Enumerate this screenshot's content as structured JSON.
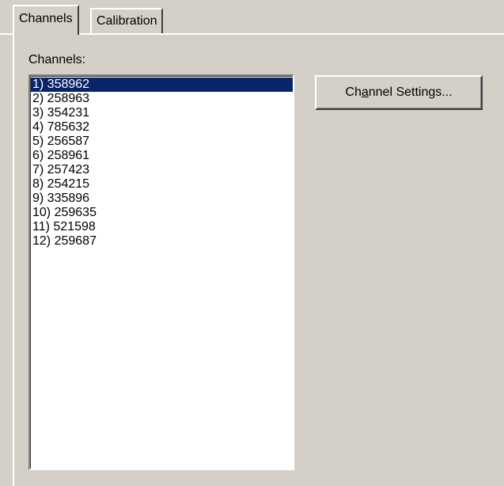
{
  "tabs": [
    {
      "label": "Channels",
      "active": true
    },
    {
      "label": "Calibration",
      "active": false
    }
  ],
  "channels_label": "Channels:",
  "channels": [
    "1) 358962",
    "2) 258963",
    "3) 354231",
    "4) 785632",
    "5) 256587",
    "6) 258961",
    "7) 257423",
    "8) 254215",
    "9) 335896",
    "10) 259635",
    "11) 521598",
    "12) 259687"
  ],
  "selected_channel": "1) 358962",
  "settings_button": {
    "pre": "Ch",
    "mnemonic": "a",
    "post": "nnel Settings..."
  },
  "colors": {
    "window": "#d4d0c8",
    "selection": "#0a246a",
    "list_bg": "#ffffff"
  }
}
